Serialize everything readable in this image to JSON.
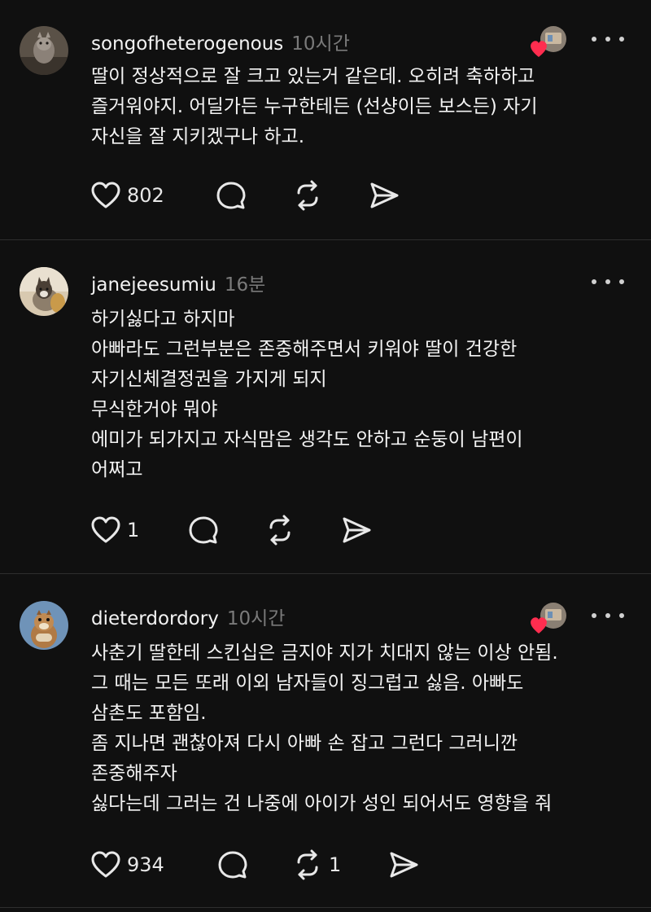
{
  "posts": [
    {
      "username": "songofheterogenous",
      "time": "10시간",
      "lines": [
        "딸이 정상적으로 잘 크고 있는거 같은데. 오히려 축하하고",
        "즐거워야지. 어딜가든 누구한테든 (선샹이든 보스든) 자기",
        "자신을 잘 지키겠구나 하고."
      ],
      "like_count": "802",
      "repost_count": ""
    },
    {
      "username": "janejeesumiu",
      "time": "16분",
      "lines": [
        "하기싫다고 하지마",
        "아빠라도 그런부분은 존중해주면서 키워야 딸이 건강한",
        "자기신체결정권을 가지게 되지",
        "무식한거야 뭐야",
        "에미가 되가지고 자식맘은 생각도 안하고 순둥이 남편이",
        "어쩌고"
      ],
      "like_count": "1",
      "repost_count": ""
    },
    {
      "username": "dieterdordory",
      "time": "10시간",
      "lines": [
        "사춘기 딸한테 스킨십은 금지야 지가 치대지 않는 이상 안됨.",
        "그 때는 모든 또래 이외 남자들이 징그럽고 싫음. 아빠도",
        "삼촌도 포함임.",
        "좀 지나면 괜찮아져 다시 아빠 손 잡고 그런다 그러니깐",
        "존중해주자",
        "싫다는데 그러는 건 나중에 아이가 성인 되어서도 영향을 줘"
      ],
      "like_count": "934",
      "repost_count": "1"
    }
  ],
  "colors": {
    "background": "#101010",
    "text": "#f3f3f3",
    "muted": "#7a7a7a",
    "divider": "#2e2e2e",
    "heart_badge": "#ff2d4f"
  },
  "icons": {
    "like": "heart-icon",
    "comment": "comment-bubble-icon",
    "repost": "repost-icon",
    "share": "send-icon",
    "more": "more-dots-icon"
  }
}
